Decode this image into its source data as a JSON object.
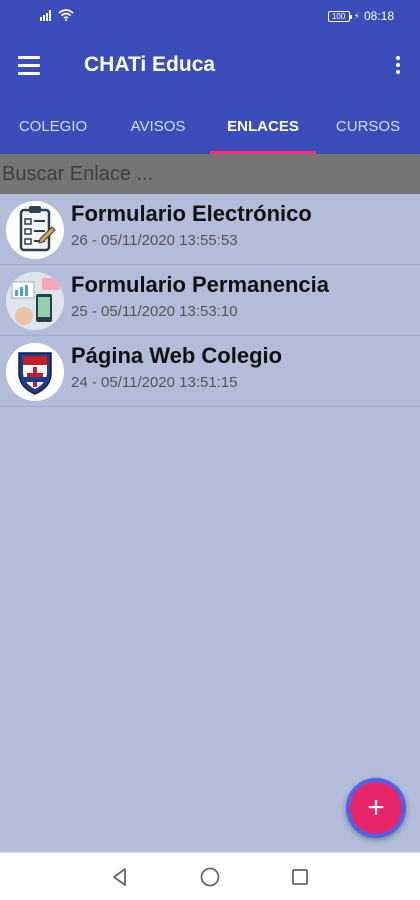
{
  "status_bar": {
    "battery": "100",
    "time": "08:18"
  },
  "app_bar": {
    "title": "CHATi Educa"
  },
  "tabs": [
    {
      "label": "COLEGIO",
      "active": false
    },
    {
      "label": "AVISOS",
      "active": false
    },
    {
      "label": "ENLACES",
      "active": true
    },
    {
      "label": "CURSOS",
      "active": false
    }
  ],
  "search": {
    "placeholder": "Buscar Enlace ..."
  },
  "links": [
    {
      "title": "Formulario Electrónico",
      "subtitle": "26 - 05/11/2020 13:55:53",
      "icon": "clipboard-form-icon"
    },
    {
      "title": "Formulario Permanencia",
      "subtitle": "25 - 05/11/2020 13:53:10",
      "icon": "phone-chart-icon"
    },
    {
      "title": "Página Web Colegio",
      "subtitle": "24 - 05/11/2020 13:51:15",
      "icon": "la-salle-shield-icon"
    }
  ],
  "fab": {
    "label": "+"
  },
  "colors": {
    "primary": "#3a4dbb",
    "accent": "#e8246a",
    "background": "#b3bcd9",
    "tab_indicator": "#ff2e7a"
  }
}
